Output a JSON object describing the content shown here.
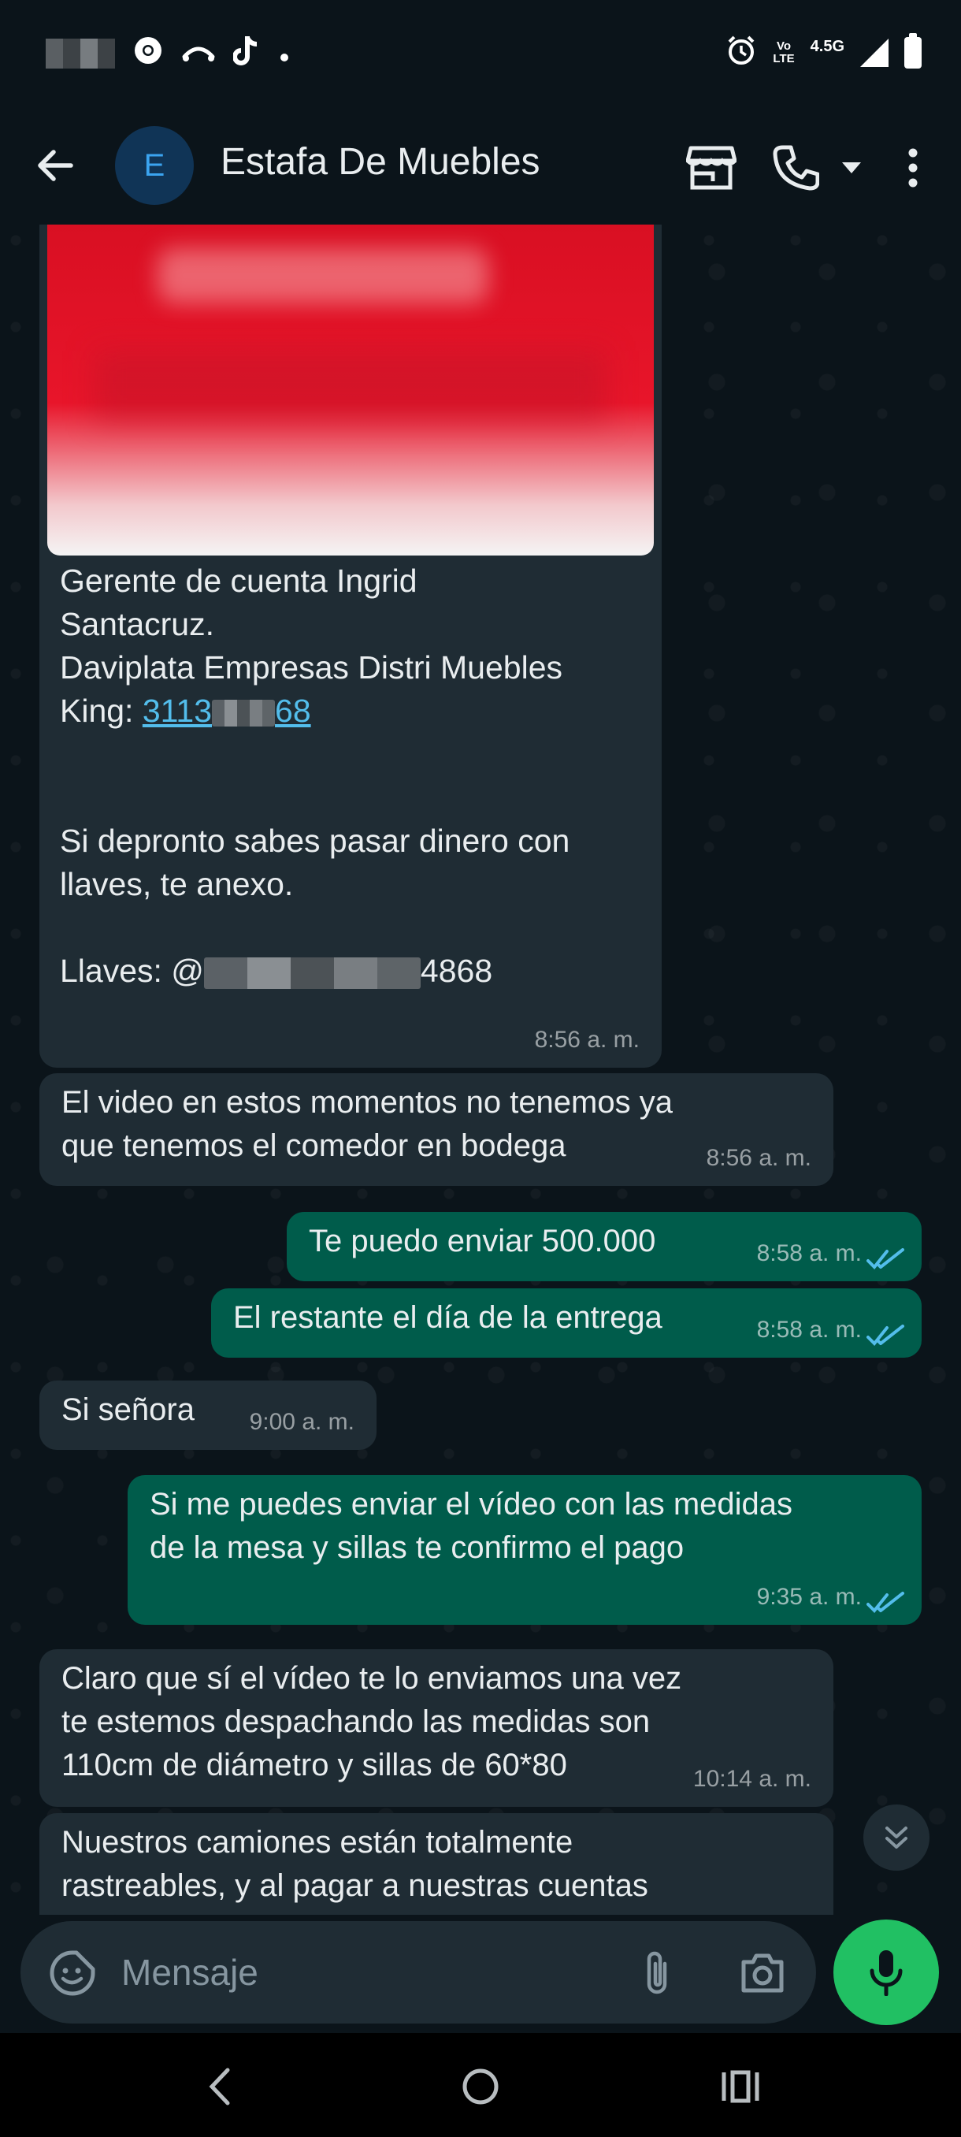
{
  "status_bar": {
    "network": "4.5G",
    "volte": "Vo\nLTE"
  },
  "header": {
    "avatar_letter": "E",
    "contact_name": "Estafa De Muebles"
  },
  "messages": [
    {
      "id": "m1",
      "direction": "in",
      "has_image": true,
      "caption_line1": "Gerente de cuenta Ingrid",
      "caption_line2": "Santacruz.",
      "caption_line3": "Daviplata Empresas Distri Muebles",
      "caption_line4_prefix": "King: ",
      "phone_visible_start": "3113",
      "phone_visible_end": "68",
      "caption_line5": "Si depronto sabes pasar dinero con",
      "caption_line6": "llaves, te anexo.",
      "keys_prefix": "Llaves: @",
      "keys_visible_end": "4868",
      "time": "8:56 a. m."
    },
    {
      "id": "m2",
      "direction": "in",
      "text": "El video en estos momentos no tenemos ya\nque tenemos el comedor en bodega",
      "time": "8:56 a. m."
    },
    {
      "id": "m3",
      "direction": "out",
      "text": "Te puedo enviar 500.000",
      "time": "8:58 a. m.",
      "status": "read"
    },
    {
      "id": "m4",
      "direction": "out",
      "text": "El restante el día de la entrega",
      "time": "8:58 a. m.",
      "status": "read"
    },
    {
      "id": "m5",
      "direction": "in",
      "text": "Si señora",
      "time": "9:00 a. m."
    },
    {
      "id": "m6",
      "direction": "out",
      "text": "Si me puedes enviar el vídeo con las medidas\nde la mesa y sillas te confirmo el pago",
      "time": "9:35 a. m.",
      "status": "read"
    },
    {
      "id": "m7",
      "direction": "in",
      "text": "Claro que sí el vídeo te lo enviamos una vez\nte estemos despachando las medidas son\n110cm de diámetro y sillas de 60*80",
      "time": "10:14 a. m."
    },
    {
      "id": "m8",
      "direction": "in",
      "text": "Nuestros camiones están totalmente\nrastreables, y al pagar a nuestras cuentas"
    }
  ],
  "composer": {
    "placeholder": "Mensaje"
  },
  "colors": {
    "background": "#0b141a",
    "incoming_bubble": "#1f2c34",
    "outgoing_bubble": "#005c4b",
    "read_ticks": "#53bdeb",
    "mic_button": "#21c063",
    "link": "#53bdeb"
  },
  "icons": {
    "back": "arrow-left-icon",
    "store": "storefront-icon",
    "call": "phone-icon",
    "call_dropdown": "caret-down-icon",
    "menu": "more-vertical-icon",
    "emoji": "sticker-icon",
    "attach": "paperclip-icon",
    "camera": "camera-icon",
    "mic": "microphone-icon",
    "scroll_down": "double-chevron-down-icon"
  }
}
